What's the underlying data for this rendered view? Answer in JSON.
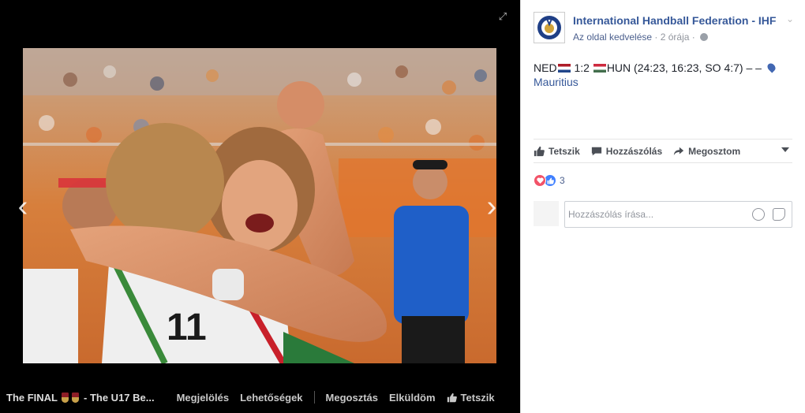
{
  "viewer": {
    "prev_arrow": "‹",
    "next_arrow": "›",
    "expand_icon": "⤢",
    "bottom_bar": {
      "title_prefix": "The FINAL",
      "title_suffix": "- The U17 Be...",
      "tag_label": "Megjelölés",
      "options_label": "Lehetőségek",
      "share_label": "Megosztás",
      "send_label": "Elküldöm",
      "like_label": "Tetszik"
    }
  },
  "post": {
    "page_name": "International Handball Federation - IHF",
    "like_page": "Az oldal kedvelése",
    "separator": "·",
    "time": "2 órája",
    "options_chevron": "⌄",
    "text_team1": "NED",
    "text_score": "1:2",
    "text_rest": "HUN (24:23, 16:23, SO 4:7) – –",
    "location": "Mauritius"
  },
  "actions": {
    "like": "Tetszik",
    "comment": "Hozzászólás",
    "share": "Megosztom"
  },
  "reactions": {
    "count": "3"
  },
  "comment_input": {
    "placeholder": "Hozzászólás írása..."
  },
  "colors": {
    "link": "#365899",
    "love": "#f25268",
    "like": "#4080ff",
    "ihf_blue": "#1f3f86",
    "ihf_gold": "#d1a33a"
  }
}
